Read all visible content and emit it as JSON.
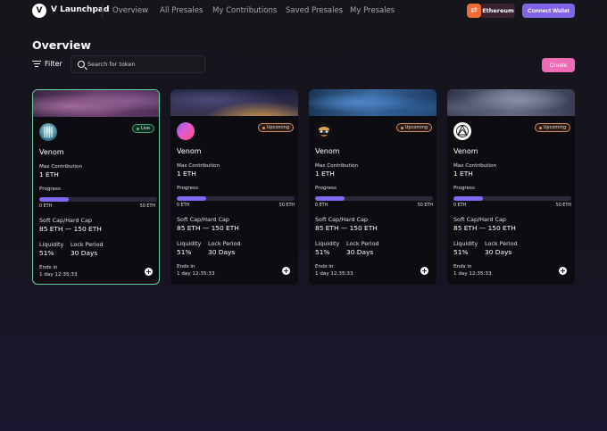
{
  "app": {
    "brand": "V Launchpad",
    "logo_letter": "V"
  },
  "nav": [
    {
      "label": "Overview",
      "active": true
    },
    {
      "label": "All Presales",
      "active": false
    },
    {
      "label": "My Contributions",
      "active": false
    },
    {
      "label": "Saved Presales",
      "active": false
    },
    {
      "label": "My Presales",
      "active": false
    }
  ],
  "network": {
    "icon": "swap-icon",
    "label": "Ethereum"
  },
  "connect_label": "Connect Wallet",
  "page": {
    "title": "Overview",
    "filter_label": "Filter",
    "search_placeholder": "Search for token",
    "create_label": "Create"
  },
  "colors": {
    "accent_pink": "#ee6bb6",
    "accent_purple": "#7c6af2",
    "live_green": "#3cd07f",
    "upcoming_orange": "#e8936b"
  },
  "cards": [
    {
      "name": "Venom",
      "status": "Live",
      "live": true,
      "avatar_icon": "venom-logo-icon",
      "max_contribution_label": "Max Contribution",
      "max_contribution": "1 ETH",
      "progress_label": "Progress",
      "progress_fraction": 0.25,
      "progress_min": "0 ETH",
      "progress_max": "50 ETH",
      "cap_label": "Soft Cap/Hard Cap",
      "cap_value": "85 ETH — 150 ETH",
      "liquidity_label": "Liquidity",
      "liquidity": "51%",
      "lock_label": "Lock Period",
      "lock": "30 Days",
      "ends_label": "Ends in",
      "ends_value": "1 day 12:35:33"
    },
    {
      "name": "Venom",
      "status": "Upcoming",
      "live": false,
      "avatar_icon": "gradient-orb-icon",
      "max_contribution_label": "Max Contribution",
      "max_contribution": "1 ETH",
      "progress_label": "Progress",
      "progress_fraction": 0.25,
      "progress_min": "0 ETH",
      "progress_max": "50 ETH",
      "cap_label": "Soft Cap/Hard Cap",
      "cap_value": "85 ETH — 150 ETH",
      "liquidity_label": "Liquidity",
      "liquidity": "51%",
      "lock_label": "Lock Period",
      "lock": "30 Days",
      "ends_label": "Ends in",
      "ends_value": "1 day 12:35:33"
    },
    {
      "name": "Venom",
      "status": "Upcoming",
      "live": false,
      "avatar_icon": "cartoon-avatar-icon",
      "max_contribution_label": "Max Contribution",
      "max_contribution": "1 ETH",
      "progress_label": "Progress",
      "progress_fraction": 0.25,
      "progress_min": "0 ETH",
      "progress_max": "50 ETH",
      "cap_label": "Soft Cap/Hard Cap",
      "cap_value": "85 ETH — 150 ETH",
      "liquidity_label": "Liquidity",
      "liquidity": "51%",
      "lock_label": "Lock Period",
      "lock": "30 Days",
      "ends_label": "Ends in",
      "ends_value": "1 day 12:35:33"
    },
    {
      "name": "Venom",
      "status": "Upcoming",
      "live": false,
      "avatar_icon": "geometric-logo-icon",
      "max_contribution_label": "Max Contribution",
      "max_contribution": "1 ETH",
      "progress_label": "Progress",
      "progress_fraction": 0.25,
      "progress_min": "0 ETH",
      "progress_max": "50 ETH",
      "cap_label": "Soft Cap/Hard Cap",
      "cap_value": "85 ETH — 150 ETH",
      "liquidity_label": "Liquidity",
      "liquidity": "51%",
      "lock_label": "Lock Period",
      "lock": "30 Days",
      "ends_label": "Ends in",
      "ends_value": "1 day 12:35:33"
    }
  ]
}
